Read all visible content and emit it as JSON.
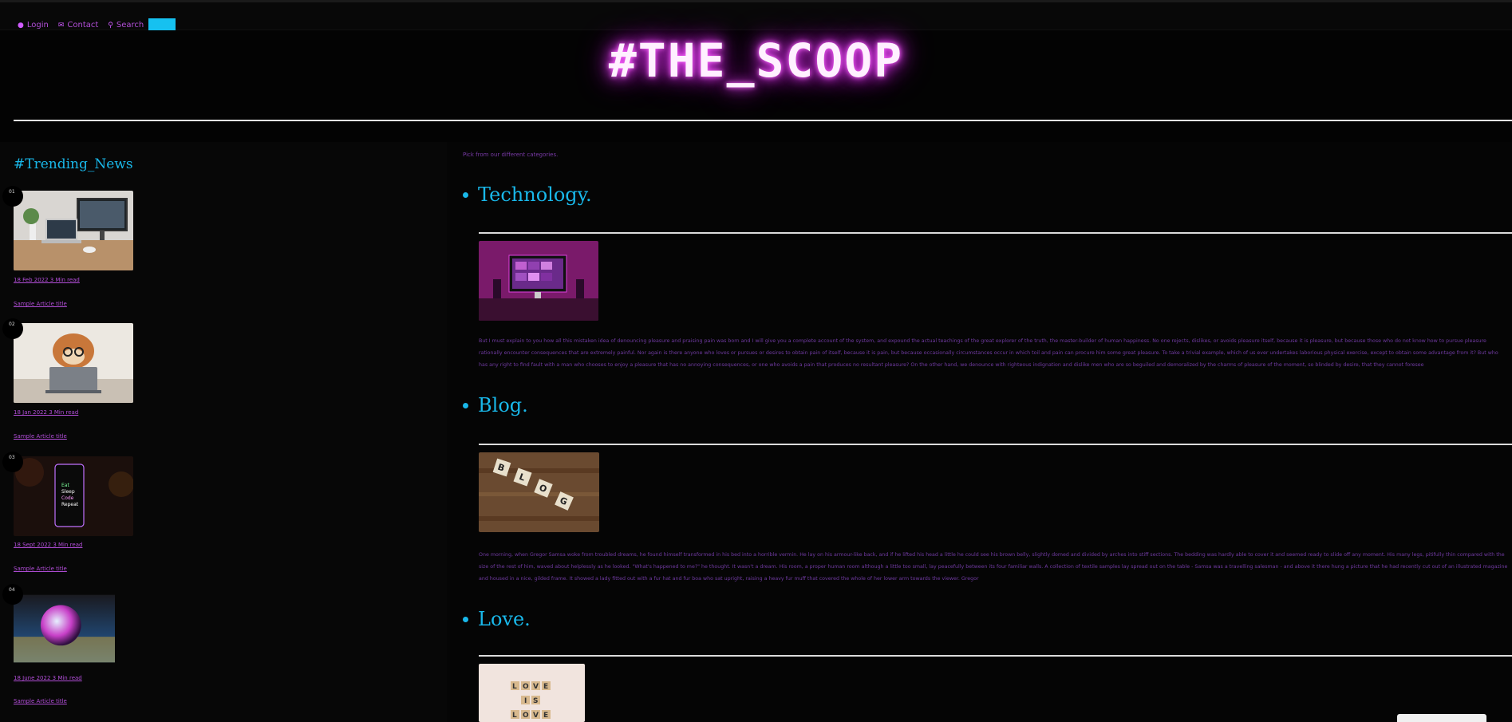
{
  "nav": {
    "items": [
      {
        "label": "Login",
        "icon": "user-icon"
      },
      {
        "label": "Contact",
        "icon": "envelope-icon"
      },
      {
        "label": "Search",
        "icon": "search-icon"
      }
    ]
  },
  "header": {
    "title": "#THE_SCOOP"
  },
  "sidebar": {
    "title": "#Trending_News",
    "cards": [
      {
        "num": "01",
        "meta": "18 Feb 2022 3 Min read",
        "link": "Sample Article title"
      },
      {
        "num": "02",
        "meta": "18 Jan 2022 3 Min read",
        "link": "Sample Article title"
      },
      {
        "num": "03",
        "meta": "18 Sept 2022 3 Min read",
        "link": "Sample Article title"
      },
      {
        "num": "04",
        "meta": "18 June 2022 3 Min read",
        "link": "Sample Article title"
      }
    ]
  },
  "main": {
    "intro": "Pick from our different categories.",
    "categories": [
      {
        "title": "Technology.",
        "text": "But I must explain to you how all this mistaken idea of denouncing pleasure and praising pain was born and I will give you a complete account of the system, and expound the actual teachings of the great explorer of the truth, the master-builder of human happiness. No one rejects, dislikes, or avoids pleasure itself, because it is pleasure, but because those who do not know how to pursue pleasure rationally encounter consequences that are extremely painful. Nor again is there anyone who loves or pursues or desires to obtain pain of itself, because it is pain, but because occasionally circumstances occur in which toil and pain can procure him some great pleasure. To take a trivial example, which of us ever undertakes laborious physical exercise, except to obtain some advantage from it? But who has any right to find fault with a man who chooses to enjoy a pleasure that has no annoying consequences, or one who avoids a pain that produces no resultant pleasure? On the other hand, we denounce with righteous indignation and dislike men who are so beguiled and demoralized by the charms of pleasure of the moment, so blinded by desire, that they cannot foresee"
      },
      {
        "title": "Blog.",
        "text": "One morning, when Gregor Samsa woke from troubled dreams, he found himself transformed in his bed into a horrible vermin. He lay on his armour-like back, and if he lifted his head a little he could see his brown belly, slightly domed and divided by arches into stiff sections. The bedding was hardly able to cover it and seemed ready to slide off any moment. His many legs, pitifully thin compared with the size of the rest of him, waved about helplessly as he looked. \"What's happened to me?\" he thought. It wasn't a dream. His room, a proper human room although a little too small, lay peacefully between its four familiar walls. A collection of textile samples lay spread out on the table - Samsa was a travelling salesman - and above it there hung a picture that he had recently cut out of an illustrated magazine and housed in a nice, gilded frame. It showed a lady fitted out with a fur hat and fur boa who sat upright, raising a heavy fur muff that covered the whole of her lower arm towards the viewer. Gregor"
      },
      {
        "title": "Love.",
        "text": ""
      }
    ]
  },
  "colors": {
    "accent_cyan": "#19b8ea",
    "accent_purple": "#b24ed8",
    "background": "#050505",
    "neon_glow": "#e040f0"
  }
}
